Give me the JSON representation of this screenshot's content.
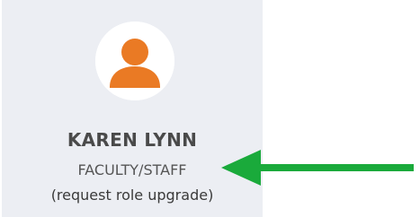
{
  "profile": {
    "name": "KAREN LYNN",
    "role": "FACULTY/STAFF",
    "upgrade_link": "(request role upgrade)"
  },
  "icons": {
    "avatar": "user-silhouette-icon",
    "pointer": "arrow-left-icon"
  },
  "colors": {
    "card_background": "#eceef3",
    "avatar_accent": "#ea7a24",
    "arrow": "#1aaa3b"
  }
}
